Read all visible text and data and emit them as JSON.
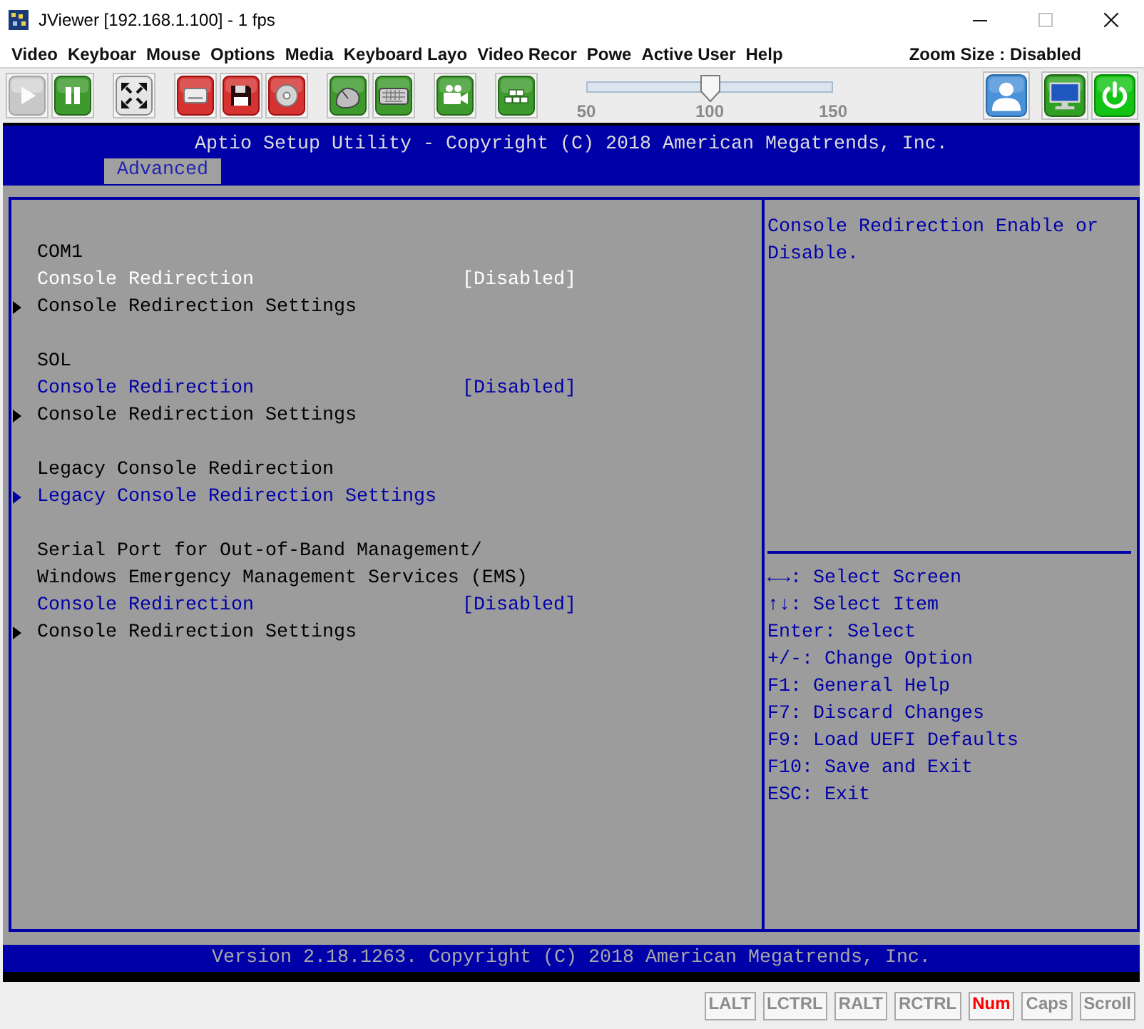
{
  "window": {
    "title": "JViewer [192.168.1.100] - 1 fps",
    "controls": [
      {
        "kind": "minimize",
        "disabled": false
      },
      {
        "kind": "maximize",
        "disabled": true
      },
      {
        "kind": "close",
        "disabled": false
      }
    ]
  },
  "menu": [
    "Video",
    "Keyboar",
    "Mouse",
    "Options",
    "Media",
    "Keyboard Layo",
    "Video Recor",
    "Powe",
    "Active User",
    "Help"
  ],
  "zoom_status": "Zoom Size : Disabled",
  "toolbar": {
    "left_groups": [
      {
        "buttons": [
          {
            "kind": "play",
            "disabled": true
          },
          {
            "kind": "pause",
            "disabled": false
          }
        ]
      },
      {
        "buttons": [
          {
            "kind": "fullscreen",
            "disabled": false
          }
        ]
      },
      {
        "buttons": [
          {
            "kind": "drive",
            "disabled": false
          },
          {
            "kind": "floppy",
            "disabled": false
          },
          {
            "kind": "cd",
            "disabled": false
          }
        ]
      },
      {
        "buttons": [
          {
            "kind": "mouse",
            "disabled": false
          },
          {
            "kind": "keyboard",
            "disabled": false
          }
        ]
      },
      {
        "buttons": [
          {
            "kind": "camera",
            "disabled": false
          }
        ]
      },
      {
        "buttons": [
          {
            "kind": "blocks",
            "disabled": false
          }
        ]
      }
    ],
    "zoom_slider": {
      "level": 0.5,
      "labels": [
        "50",
        "100",
        "150"
      ]
    },
    "right_groups": [
      {
        "buttons": [
          {
            "kind": "user",
            "disabled": false
          }
        ]
      },
      {
        "buttons": [
          {
            "kind": "monitor",
            "disabled": false
          },
          {
            "kind": "power",
            "disabled": false
          }
        ]
      }
    ]
  },
  "bios": {
    "title": "Aptio Setup Utility - Copyright (C) 2018 American Megatrends, Inc.",
    "tabs": [
      {
        "label": "Advanced",
        "selected": true
      }
    ],
    "sections": [
      {
        "items": [
          {
            "kind": "heading",
            "label": "COM1",
            "selected": false
          },
          {
            "kind": "option",
            "label": "Console Redirection",
            "value": "[Disabled]",
            "selected": true,
            "disabled": false
          },
          {
            "kind": "submenu",
            "label": "Console Redirection Settings",
            "selected": false,
            "disabled": true
          }
        ]
      },
      {
        "items": [
          {
            "kind": "heading",
            "label": "SOL",
            "selected": false
          },
          {
            "kind": "option",
            "label": "Console Redirection",
            "value": "[Disabled]",
            "selected": false,
            "disabled": false
          },
          {
            "kind": "submenu",
            "label": "Console Redirection Settings",
            "selected": false,
            "disabled": true
          }
        ]
      },
      {
        "items": [
          {
            "kind": "heading",
            "label": "Legacy Console Redirection",
            "selected": false
          },
          {
            "kind": "submenu",
            "label": "Legacy Console Redirection Settings",
            "selected": false,
            "disabled": false
          }
        ]
      },
      {
        "items": [
          {
            "kind": "heading",
            "label": "Serial Port for Out-of-Band Management/",
            "selected": false
          },
          {
            "kind": "heading",
            "label": "Windows Emergency Management Services (EMS)",
            "selected": false
          },
          {
            "kind": "option",
            "label": "Console Redirection",
            "value": "[Disabled]",
            "selected": false,
            "disabled": false
          },
          {
            "kind": "submenu",
            "label": "Console Redirection Settings",
            "selected": false,
            "disabled": true
          }
        ]
      }
    ],
    "help_text": "Console Redirection Enable or Disable.",
    "key_help": [
      "←→: Select Screen",
      "↑↓: Select Item",
      "Enter: Select",
      "+/-: Change Option",
      "F1: General Help",
      "F7: Discard Changes",
      "F9: Load UEFI Defaults",
      "F10: Save and Exit",
      "ESC: Exit"
    ],
    "footer": "Version 2.18.1263. Copyright (C) 2018 American Megatrends, Inc."
  },
  "status_keys": [
    {
      "label": "LALT",
      "on": false
    },
    {
      "label": "LCTRL",
      "on": false
    },
    {
      "label": "RALT",
      "on": false
    },
    {
      "label": "RCTRL",
      "on": false
    },
    {
      "label": "Num",
      "on": true
    },
    {
      "label": "Caps",
      "on": false
    },
    {
      "label": "Scroll",
      "on": false
    }
  ]
}
